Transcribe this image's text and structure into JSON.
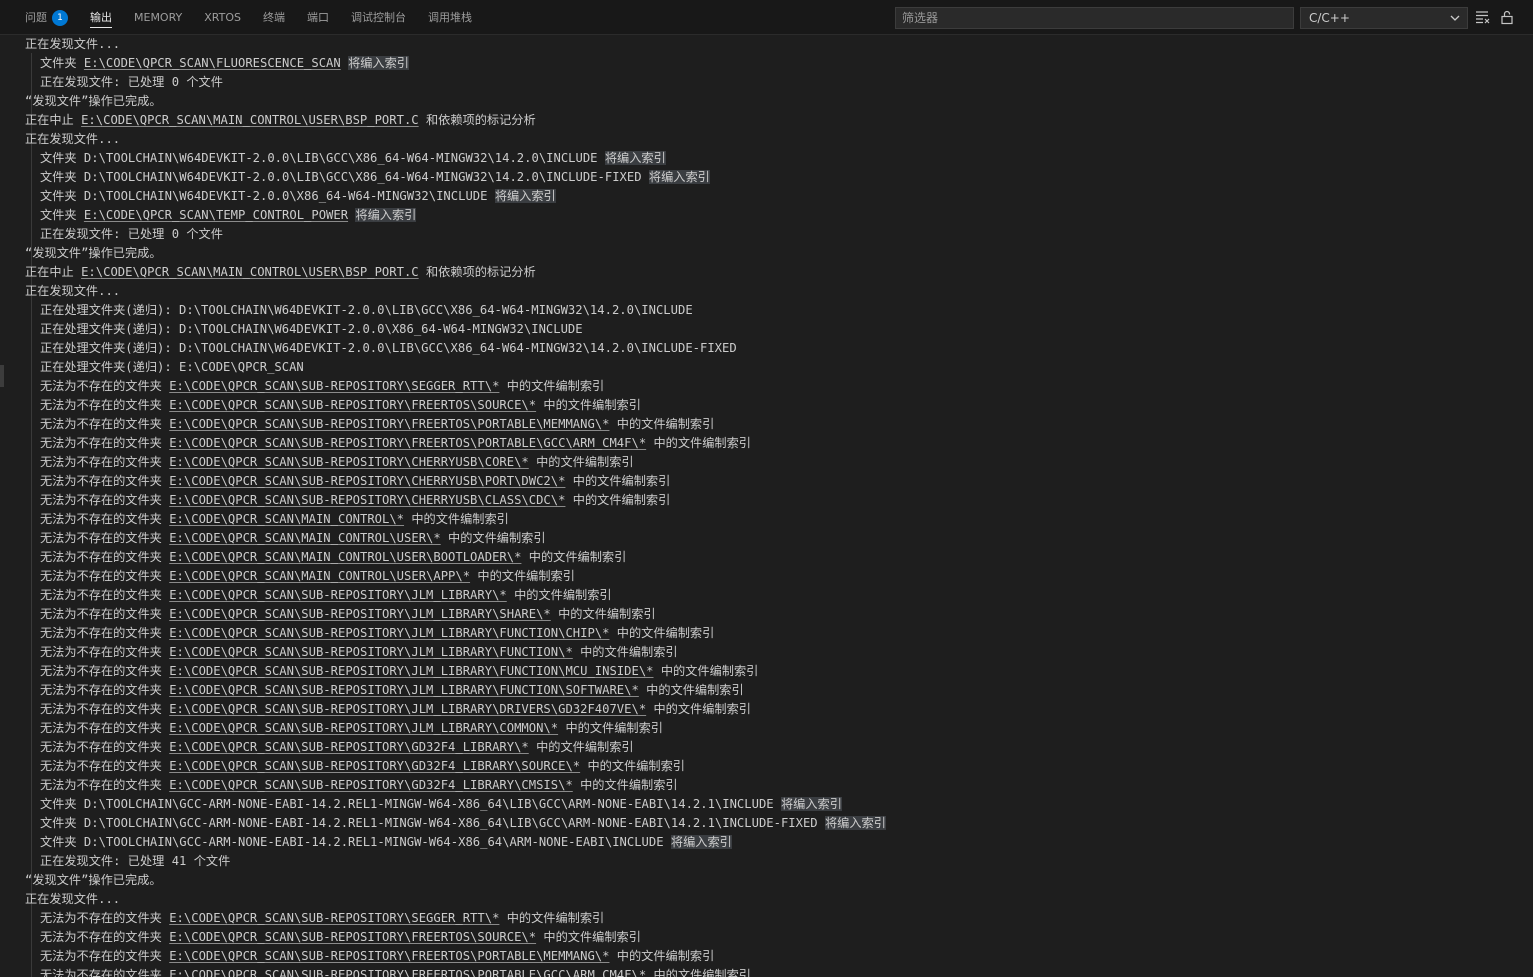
{
  "tabs": [
    {
      "label": "问题",
      "badge": "1",
      "active": false
    },
    {
      "label": "输出",
      "active": true
    },
    {
      "label": "MEMORY",
      "active": false
    },
    {
      "label": "XRTOS",
      "active": false
    },
    {
      "label": "终端",
      "active": false
    },
    {
      "label": "端口",
      "active": false
    },
    {
      "label": "调试控制台",
      "active": false
    },
    {
      "label": "调用堆栈",
      "active": false
    }
  ],
  "filter": {
    "placeholder": "筛选器"
  },
  "channel_select": {
    "value": "C/C++"
  },
  "toolbar": {
    "icons": [
      "clear-output-icon",
      "lock-scroll-icon"
    ]
  },
  "output_lines": [
    {
      "indent": false,
      "parts": [
        {
          "t": "正在发现文件..."
        }
      ]
    },
    {
      "indent": true,
      "parts": [
        {
          "t": "文件夹 "
        },
        {
          "t": "E:\\CODE\\QPCR_SCAN\\FLUORESCENCE_SCAN",
          "link": true
        },
        {
          "t": " "
        },
        {
          "t": "将编入索引",
          "hl": true
        }
      ]
    },
    {
      "indent": true,
      "parts": [
        {
          "t": "正在发现文件: 已处理 0 个文件"
        }
      ]
    },
    {
      "indent": false,
      "parts": [
        {
          "t": "“发现文件”操作已完成。"
        }
      ]
    },
    {
      "indent": false,
      "parts": [
        {
          "t": "正在中止 "
        },
        {
          "t": "E:\\CODE\\QPCR_SCAN\\MAIN_CONTROL\\USER\\BSP_PORT.C",
          "link": true
        },
        {
          "t": " 和依赖项的标记分析"
        }
      ]
    },
    {
      "indent": false,
      "parts": [
        {
          "t": "正在发现文件..."
        }
      ]
    },
    {
      "indent": true,
      "parts": [
        {
          "t": "文件夹 D:\\TOOLCHAIN\\W64DEVKIT-2.0.0\\LIB\\GCC\\X86_64-W64-MINGW32\\14.2.0\\INCLUDE "
        },
        {
          "t": "将编入索引",
          "hl": true
        }
      ]
    },
    {
      "indent": true,
      "parts": [
        {
          "t": "文件夹 D:\\TOOLCHAIN\\W64DEVKIT-2.0.0\\LIB\\GCC\\X86_64-W64-MINGW32\\14.2.0\\INCLUDE-FIXED "
        },
        {
          "t": "将编入索引",
          "hl": true
        }
      ]
    },
    {
      "indent": true,
      "parts": [
        {
          "t": "文件夹 D:\\TOOLCHAIN\\W64DEVKIT-2.0.0\\X86_64-W64-MINGW32\\INCLUDE "
        },
        {
          "t": "将编入索引",
          "hl": true
        }
      ]
    },
    {
      "indent": true,
      "parts": [
        {
          "t": "文件夹 "
        },
        {
          "t": "E:\\CODE\\QPCR_SCAN\\TEMP_CONTROL_POWER",
          "link": true
        },
        {
          "t": " "
        },
        {
          "t": "将编入索引",
          "hl": true
        }
      ]
    },
    {
      "indent": true,
      "parts": [
        {
          "t": "正在发现文件: 已处理 0 个文件"
        }
      ]
    },
    {
      "indent": false,
      "parts": [
        {
          "t": "“发现文件”操作已完成。"
        }
      ]
    },
    {
      "indent": false,
      "parts": [
        {
          "t": "正在中止 "
        },
        {
          "t": "E:\\CODE\\QPCR_SCAN\\MAIN_CONTROL\\USER\\BSP_PORT.C",
          "link": true
        },
        {
          "t": " 和依赖项的标记分析"
        }
      ]
    },
    {
      "indent": false,
      "parts": [
        {
          "t": "正在发现文件..."
        }
      ]
    },
    {
      "indent": true,
      "parts": [
        {
          "t": "正在处理文件夹(递归): D:\\TOOLCHAIN\\W64DEVKIT-2.0.0\\LIB\\GCC\\X86_64-W64-MINGW32\\14.2.0\\INCLUDE"
        }
      ]
    },
    {
      "indent": true,
      "parts": [
        {
          "t": "正在处理文件夹(递归): D:\\TOOLCHAIN\\W64DEVKIT-2.0.0\\X86_64-W64-MINGW32\\INCLUDE"
        }
      ]
    },
    {
      "indent": true,
      "parts": [
        {
          "t": "正在处理文件夹(递归): D:\\TOOLCHAIN\\W64DEVKIT-2.0.0\\LIB\\GCC\\X86_64-W64-MINGW32\\14.2.0\\INCLUDE-FIXED"
        }
      ]
    },
    {
      "indent": true,
      "parts": [
        {
          "t": "正在处理文件夹(递归): E:\\CODE\\QPCR_SCAN"
        }
      ]
    },
    {
      "indent": true,
      "parts": [
        {
          "t": "无法为不存在的文件夹 "
        },
        {
          "t": "E:\\CODE\\QPCR_SCAN\\SUB-REPOSITORY\\SEGGER_RTT\\*",
          "link": true
        },
        {
          "t": " 中的文件编制索引"
        }
      ]
    },
    {
      "indent": true,
      "parts": [
        {
          "t": "无法为不存在的文件夹 "
        },
        {
          "t": "E:\\CODE\\QPCR_SCAN\\SUB-REPOSITORY\\FREERTOS\\SOURCE\\*",
          "link": true
        },
        {
          "t": " 中的文件编制索引"
        }
      ]
    },
    {
      "indent": true,
      "parts": [
        {
          "t": "无法为不存在的文件夹 "
        },
        {
          "t": "E:\\CODE\\QPCR_SCAN\\SUB-REPOSITORY\\FREERTOS\\PORTABLE\\MEMMANG\\*",
          "link": true
        },
        {
          "t": " 中的文件编制索引"
        }
      ]
    },
    {
      "indent": true,
      "parts": [
        {
          "t": "无法为不存在的文件夹 "
        },
        {
          "t": "E:\\CODE\\QPCR_SCAN\\SUB-REPOSITORY\\FREERTOS\\PORTABLE\\GCC\\ARM_CM4F\\*",
          "link": true
        },
        {
          "t": " 中的文件编制索引"
        }
      ]
    },
    {
      "indent": true,
      "parts": [
        {
          "t": "无法为不存在的文件夹 "
        },
        {
          "t": "E:\\CODE\\QPCR_SCAN\\SUB-REPOSITORY\\CHERRYUSB\\CORE\\*",
          "link": true
        },
        {
          "t": " 中的文件编制索引"
        }
      ]
    },
    {
      "indent": true,
      "parts": [
        {
          "t": "无法为不存在的文件夹 "
        },
        {
          "t": "E:\\CODE\\QPCR_SCAN\\SUB-REPOSITORY\\CHERRYUSB\\PORT\\DWC2\\*",
          "link": true
        },
        {
          "t": " 中的文件编制索引"
        }
      ]
    },
    {
      "indent": true,
      "parts": [
        {
          "t": "无法为不存在的文件夹 "
        },
        {
          "t": "E:\\CODE\\QPCR_SCAN\\SUB-REPOSITORY\\CHERRYUSB\\CLASS\\CDC\\*",
          "link": true
        },
        {
          "t": " 中的文件编制索引"
        }
      ]
    },
    {
      "indent": true,
      "parts": [
        {
          "t": "无法为不存在的文件夹 "
        },
        {
          "t": "E:\\CODE\\QPCR_SCAN\\MAIN_CONTROL\\*",
          "link": true
        },
        {
          "t": " 中的文件编制索引"
        }
      ]
    },
    {
      "indent": true,
      "parts": [
        {
          "t": "无法为不存在的文件夹 "
        },
        {
          "t": "E:\\CODE\\QPCR_SCAN\\MAIN_CONTROL\\USER\\*",
          "link": true
        },
        {
          "t": " 中的文件编制索引"
        }
      ]
    },
    {
      "indent": true,
      "parts": [
        {
          "t": "无法为不存在的文件夹 "
        },
        {
          "t": "E:\\CODE\\QPCR_SCAN\\MAIN_CONTROL\\USER\\BOOTLOADER\\*",
          "link": true
        },
        {
          "t": " 中的文件编制索引"
        }
      ]
    },
    {
      "indent": true,
      "parts": [
        {
          "t": "无法为不存在的文件夹 "
        },
        {
          "t": "E:\\CODE\\QPCR_SCAN\\MAIN_CONTROL\\USER\\APP\\*",
          "link": true
        },
        {
          "t": " 中的文件编制索引"
        }
      ]
    },
    {
      "indent": true,
      "parts": [
        {
          "t": "无法为不存在的文件夹 "
        },
        {
          "t": "E:\\CODE\\QPCR_SCAN\\SUB-REPOSITORY\\JLM_LIBRARY\\*",
          "link": true
        },
        {
          "t": " 中的文件编制索引"
        }
      ]
    },
    {
      "indent": true,
      "parts": [
        {
          "t": "无法为不存在的文件夹 "
        },
        {
          "t": "E:\\CODE\\QPCR_SCAN\\SUB-REPOSITORY\\JLM_LIBRARY\\SHARE\\*",
          "link": true
        },
        {
          "t": " 中的文件编制索引"
        }
      ]
    },
    {
      "indent": true,
      "parts": [
        {
          "t": "无法为不存在的文件夹 "
        },
        {
          "t": "E:\\CODE\\QPCR_SCAN\\SUB-REPOSITORY\\JLM_LIBRARY\\FUNCTION\\CHIP\\*",
          "link": true
        },
        {
          "t": " 中的文件编制索引"
        }
      ]
    },
    {
      "indent": true,
      "parts": [
        {
          "t": "无法为不存在的文件夹 "
        },
        {
          "t": "E:\\CODE\\QPCR_SCAN\\SUB-REPOSITORY\\JLM_LIBRARY\\FUNCTION\\*",
          "link": true
        },
        {
          "t": " 中的文件编制索引"
        }
      ]
    },
    {
      "indent": true,
      "parts": [
        {
          "t": "无法为不存在的文件夹 "
        },
        {
          "t": "E:\\CODE\\QPCR_SCAN\\SUB-REPOSITORY\\JLM_LIBRARY\\FUNCTION\\MCU_INSIDE\\*",
          "link": true
        },
        {
          "t": " 中的文件编制索引"
        }
      ]
    },
    {
      "indent": true,
      "parts": [
        {
          "t": "无法为不存在的文件夹 "
        },
        {
          "t": "E:\\CODE\\QPCR_SCAN\\SUB-REPOSITORY\\JLM_LIBRARY\\FUNCTION\\SOFTWARE\\*",
          "link": true
        },
        {
          "t": " 中的文件编制索引"
        }
      ]
    },
    {
      "indent": true,
      "parts": [
        {
          "t": "无法为不存在的文件夹 "
        },
        {
          "t": "E:\\CODE\\QPCR_SCAN\\SUB-REPOSITORY\\JLM_LIBRARY\\DRIVERS\\GD32F407VE\\*",
          "link": true
        },
        {
          "t": " 中的文件编制索引"
        }
      ]
    },
    {
      "indent": true,
      "parts": [
        {
          "t": "无法为不存在的文件夹 "
        },
        {
          "t": "E:\\CODE\\QPCR_SCAN\\SUB-REPOSITORY\\JLM_LIBRARY\\COMMON\\*",
          "link": true
        },
        {
          "t": " 中的文件编制索引"
        }
      ]
    },
    {
      "indent": true,
      "parts": [
        {
          "t": "无法为不存在的文件夹 "
        },
        {
          "t": "E:\\CODE\\QPCR_SCAN\\SUB-REPOSITORY\\GD32F4_LIBRARY\\*",
          "link": true
        },
        {
          "t": " 中的文件编制索引"
        }
      ]
    },
    {
      "indent": true,
      "parts": [
        {
          "t": "无法为不存在的文件夹 "
        },
        {
          "t": "E:\\CODE\\QPCR_SCAN\\SUB-REPOSITORY\\GD32F4_LIBRARY\\SOURCE\\*",
          "link": true
        },
        {
          "t": " 中的文件编制索引"
        }
      ]
    },
    {
      "indent": true,
      "parts": [
        {
          "t": "无法为不存在的文件夹 "
        },
        {
          "t": "E:\\CODE\\QPCR_SCAN\\SUB-REPOSITORY\\GD32F4_LIBRARY\\CMSIS\\*",
          "link": true
        },
        {
          "t": " 中的文件编制索引"
        }
      ]
    },
    {
      "indent": true,
      "parts": [
        {
          "t": "文件夹 D:\\TOOLCHAIN\\GCC-ARM-NONE-EABI-14.2.REL1-MINGW-W64-X86_64\\LIB\\GCC\\ARM-NONE-EABI\\14.2.1\\INCLUDE "
        },
        {
          "t": "将编入索引",
          "hl": true
        }
      ]
    },
    {
      "indent": true,
      "parts": [
        {
          "t": "文件夹 D:\\TOOLCHAIN\\GCC-ARM-NONE-EABI-14.2.REL1-MINGW-W64-X86_64\\LIB\\GCC\\ARM-NONE-EABI\\14.2.1\\INCLUDE-FIXED "
        },
        {
          "t": "将编入索引",
          "hl": true
        }
      ]
    },
    {
      "indent": true,
      "parts": [
        {
          "t": "文件夹 D:\\TOOLCHAIN\\GCC-ARM-NONE-EABI-14.2.REL1-MINGW-W64-X86_64\\ARM-NONE-EABI\\INCLUDE "
        },
        {
          "t": "将编入索引",
          "hl": true
        }
      ]
    },
    {
      "indent": true,
      "parts": [
        {
          "t": "正在发现文件: 已处理 41 个文件"
        }
      ]
    },
    {
      "indent": false,
      "parts": [
        {
          "t": "“发现文件”操作已完成。"
        }
      ]
    },
    {
      "indent": false,
      "parts": [
        {
          "t": "正在发现文件..."
        }
      ]
    },
    {
      "indent": true,
      "parts": [
        {
          "t": "无法为不存在的文件夹 "
        },
        {
          "t": "E:\\CODE\\QPCR_SCAN\\SUB-REPOSITORY\\SEGGER_RTT\\*",
          "link": true
        },
        {
          "t": " 中的文件编制索引"
        }
      ]
    },
    {
      "indent": true,
      "parts": [
        {
          "t": "无法为不存在的文件夹 "
        },
        {
          "t": "E:\\CODE\\QPCR_SCAN\\SUB-REPOSITORY\\FREERTOS\\SOURCE\\*",
          "link": true
        },
        {
          "t": " 中的文件编制索引"
        }
      ]
    },
    {
      "indent": true,
      "parts": [
        {
          "t": "无法为不存在的文件夹 "
        },
        {
          "t": "E:\\CODE\\QPCR_SCAN\\SUB-REPOSITORY\\FREERTOS\\PORTABLE\\MEMMANG\\*",
          "link": true
        },
        {
          "t": " 中的文件编制索引"
        }
      ]
    },
    {
      "indent": true,
      "parts": [
        {
          "t": "无法为不存在的文件夹 "
        },
        {
          "t": "E:\\CODE\\QPCR_SCAN\\SUB-REPOSITORY\\FREERTOS\\PORTABLE\\GCC\\ARM_CM4F\\*",
          "link": true
        },
        {
          "t": " 中的文件编制索引"
        }
      ]
    }
  ]
}
